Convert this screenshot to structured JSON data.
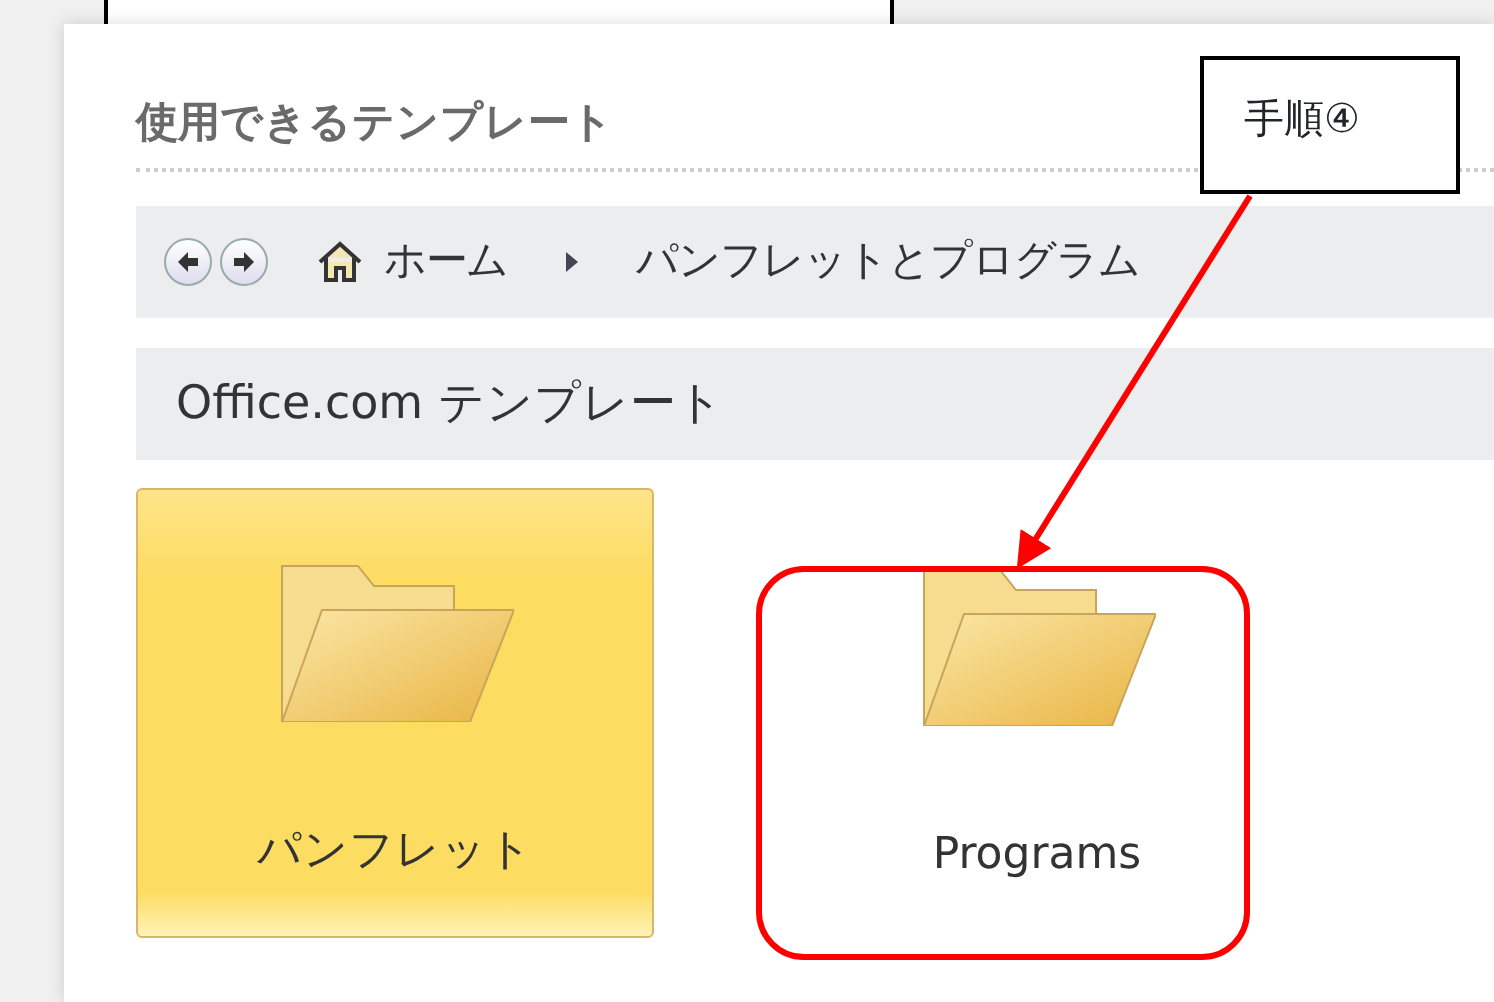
{
  "panel_title": "使用できるテンプレート",
  "breadcrumb": {
    "home": "ホーム",
    "current": "パンフレットとプログラム"
  },
  "section_header": "Office.com テンプレート",
  "templates": [
    {
      "label": "パンフレット",
      "selected": true
    },
    {
      "label": "Programs",
      "selected": false
    }
  ],
  "callout": {
    "text": "手順④"
  }
}
